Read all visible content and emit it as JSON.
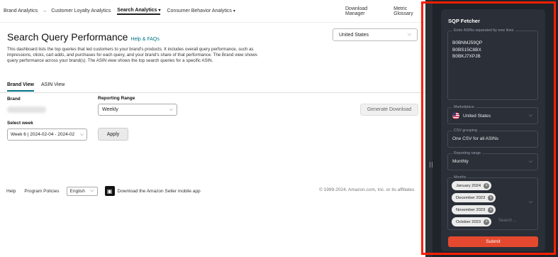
{
  "topnav": {
    "items": [
      {
        "label": "Brand Analytics",
        "dropdown": false
      },
      {
        "label": "Customer Loyalty Analytics",
        "dropdown": false
      },
      {
        "label": "Search Analytics",
        "dropdown": true,
        "active": true
      },
      {
        "label": "Consumer Behavior Analytics",
        "dropdown": true
      }
    ],
    "separator": "→",
    "download_manager": "Download Manager",
    "metric_glossary": "Metric Glossary"
  },
  "header": {
    "title": "Search Query Performance",
    "help_link": "Help & FAQs",
    "description": "This dashboard lists the top queries that led customers to your brand's products. It includes overall query performance, such as impressions, clicks, cart adds, and purchases for each query, and your brand's share of that performance. The Brand view shows query performance across your brand(s). The ASIN view shows the top search queries for a specific ASIN.",
    "country_select": "United States"
  },
  "tabs": [
    {
      "label": "Brand View",
      "selected": true
    },
    {
      "label": "ASIN View",
      "selected": false
    }
  ],
  "filters": {
    "brand_label": "Brand",
    "reporting_range_label": "Reporting Range",
    "reporting_range_value": "Weekly",
    "select_week_label": "Select week",
    "week_value": "Week 6 | 2024-02-04 - 2024-02",
    "apply_label": "Apply",
    "generate_download_label": "Generate Download"
  },
  "footer": {
    "help": "Help",
    "program_policies": "Program Policies",
    "language": "English",
    "app_text": "Download the Amazon Seller mobile app",
    "copyright": "© 1999-2024, Amazon.com, Inc. or its affiliates"
  },
  "extension": {
    "title": "SQP Fetcher",
    "asins_label": "Enter ASINs separated by new lines",
    "asins": [
      "B0BNMJ59QP",
      "B0BS15C8BX",
      "B0BKJ7XPJB"
    ],
    "marketplace_label": "Marketplace",
    "marketplace_value": "United States",
    "csv_grouping_label": "CSV grouping",
    "csv_grouping_value": "One CSV for all ASINs",
    "reporting_range_label": "Reporting range",
    "reporting_range_value": "Monthly",
    "months_label": "Months",
    "months": [
      "January 2024",
      "December 2023",
      "November 2023",
      "October 2023"
    ],
    "search_placeholder": "Search ...",
    "submit_label": "Submit"
  },
  "colors": {
    "accent_teal": "#007185",
    "panel_bg": "#2a2f38",
    "submit": "#e4492f",
    "highlight_frame": "#ff1e00"
  },
  "icons": [
    "chevron-down-icon",
    "us-flag-icon",
    "chip-remove-icon",
    "amazon-app-icon",
    "resize-grip-icon"
  ]
}
